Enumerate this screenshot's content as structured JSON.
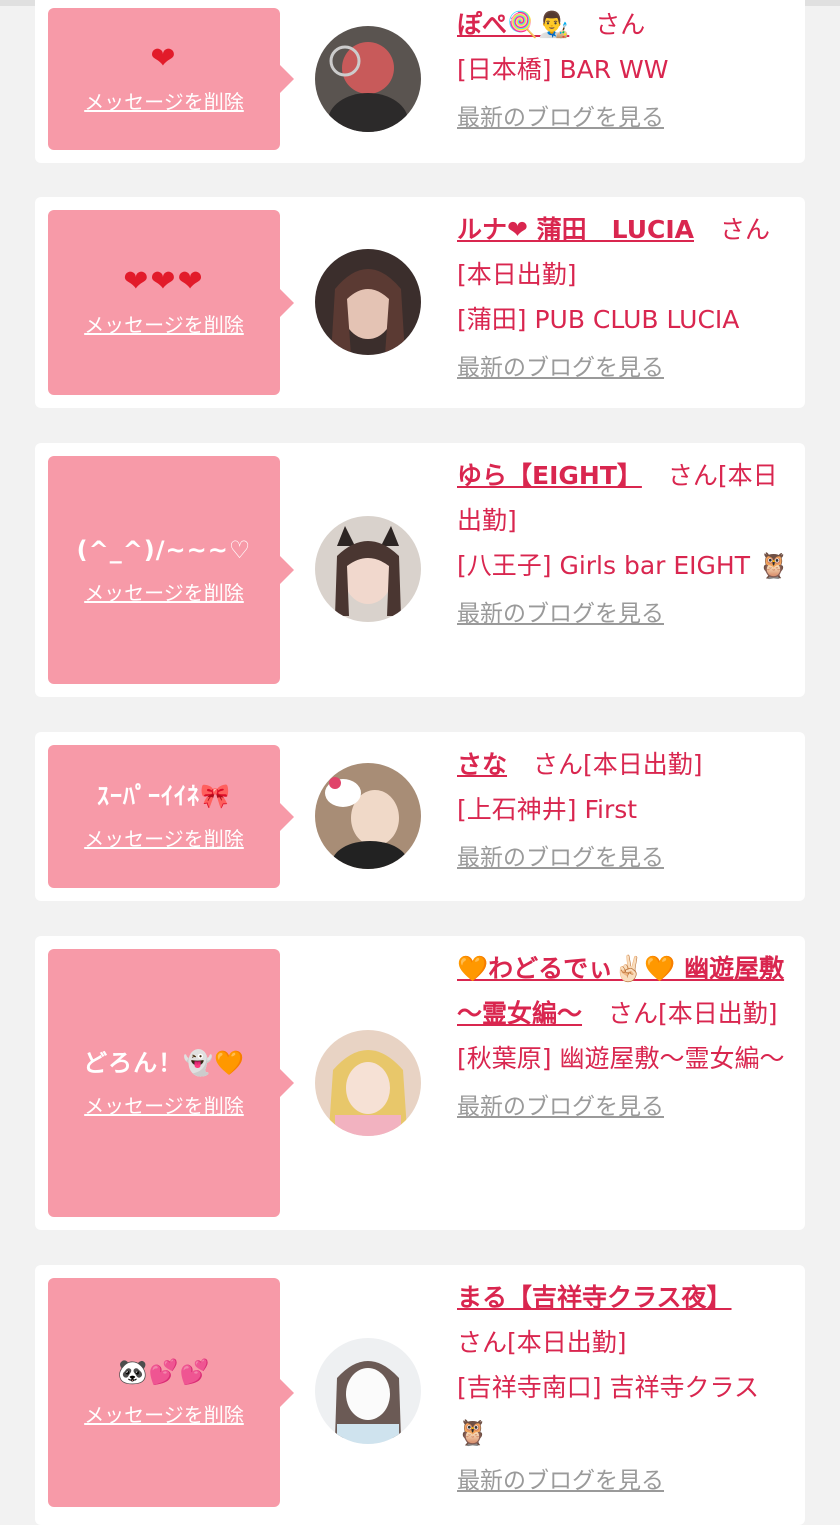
{
  "delete_label": "メッセージを削除",
  "blog_label": "最新のブログを見る",
  "cards": [
    {
      "message": "❤",
      "name": "ぽぺ🍭👨‍🎨",
      "suffix": "さん",
      "location": "[日本橋] BAR WW"
    },
    {
      "message": "❤❤❤",
      "name": "ルナ❤ 蒲田　LUCIA",
      "suffix": "さん[本日出勤]",
      "location": "[蒲田] PUB CLUB LUCIA"
    },
    {
      "message": "(^_^)/~~~♡",
      "name": "ゆら【EIGHT】",
      "suffix": "さん[本日出勤]",
      "location": "[八王子] Girls bar EIGHT 🦉"
    },
    {
      "message": "ｽｰﾊﾟｰｲｲﾈ🎀",
      "name": "さな",
      "suffix": "さん[本日出勤]",
      "location": "[上石神井] First"
    },
    {
      "message": "どろん！👻🧡",
      "name": "🧡わどるでぃ✌🏻🧡 幽遊屋敷 〜霊女編〜",
      "suffix": "さん[本日出勤]",
      "location": "[秋葉原] 幽遊屋敷〜霊女編〜"
    },
    {
      "message": "🐼💕💕",
      "name": "まる【吉祥寺クラス夜】",
      "suffix": "さん[本日出勤]",
      "location": "[吉祥寺南口] 吉祥寺クラス 🦉"
    }
  ],
  "colors": {
    "accent": "#d9264f",
    "bubble": "#f79aa8",
    "background": "#f2f2f2",
    "link_gray": "#9a9a9a"
  }
}
